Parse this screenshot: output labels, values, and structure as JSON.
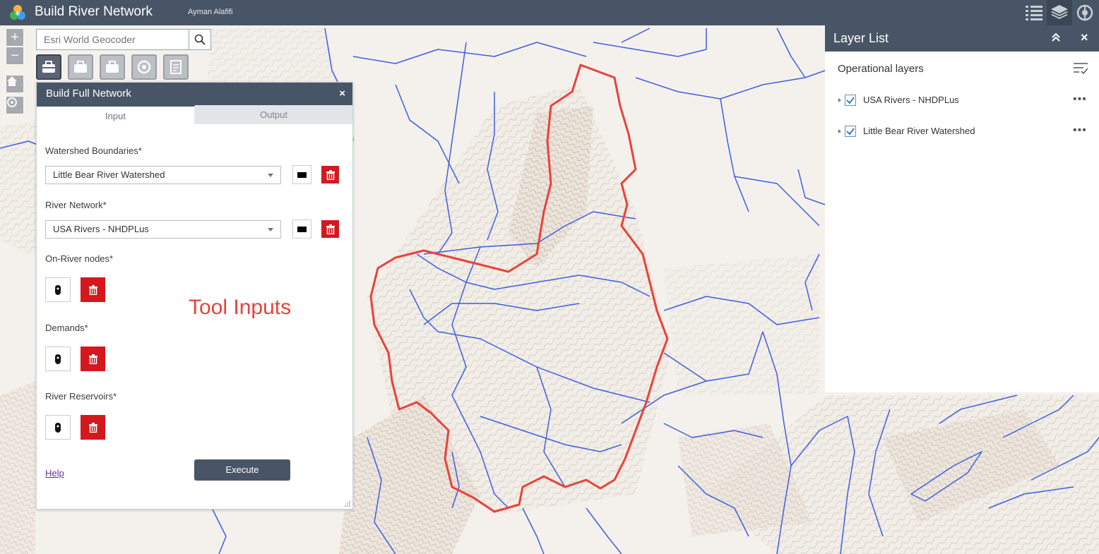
{
  "app": {
    "title": "Build River Network",
    "user": "Ayman Alafifi"
  },
  "header_buttons": [
    {
      "icon": "list-icon"
    },
    {
      "icon": "layers-icon"
    },
    {
      "icon": "tool-icon"
    }
  ],
  "search": {
    "placeholder": "Esri World Geocoder"
  },
  "panel": {
    "title": "Build Full Network",
    "close_label": "×",
    "tabs": {
      "input": "Input",
      "output": "Output"
    },
    "fields": {
      "watershed_label": "Watershed Boundaries*",
      "watershed_value": "Little Bear River Watershed",
      "river_label": "River Network*",
      "river_value": "USA Rivers - NHDPLus",
      "nodes_label": "On-River nodes*",
      "demands_label": "Demands*",
      "reservoirs_label": "River Reservoirs*"
    },
    "help": "Help",
    "execute": "Execute"
  },
  "annotation": "Tool Inputs",
  "layer_list": {
    "title": "Layer List",
    "close_label": "×",
    "section": "Operational layers",
    "layers": [
      {
        "label": "USA Rivers - NHDPLus",
        "checked": true
      },
      {
        "label": "Little Bear River Watershed",
        "checked": true
      }
    ],
    "more": "•••"
  },
  "colors": {
    "header": "#485566",
    "delete": "#d5181e",
    "river": "#3f5ee0",
    "watershed": "#e8423a"
  }
}
